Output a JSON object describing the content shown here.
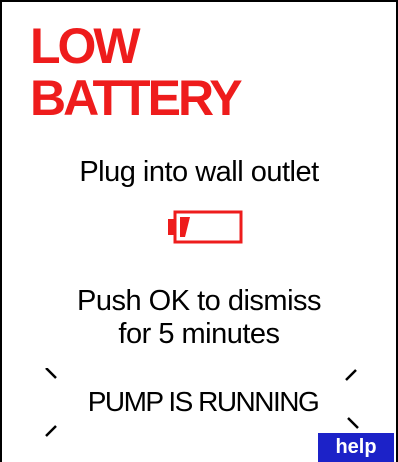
{
  "alert": {
    "title_line1": "LOW",
    "title_line2": "BATTERY",
    "title_color": "#ee1c1c"
  },
  "instruction": "Plug into wall outlet",
  "battery_icon": {
    "name": "low-battery-icon",
    "color": "#ee1c1c"
  },
  "dismiss": {
    "line1": "Push OK to dismiss",
    "line2": "for 5 minutes"
  },
  "status": {
    "text": "PUMP IS RUNNING",
    "indicator": "blink-rays"
  },
  "help_button": {
    "label": "help",
    "color": "#1c22c8"
  }
}
